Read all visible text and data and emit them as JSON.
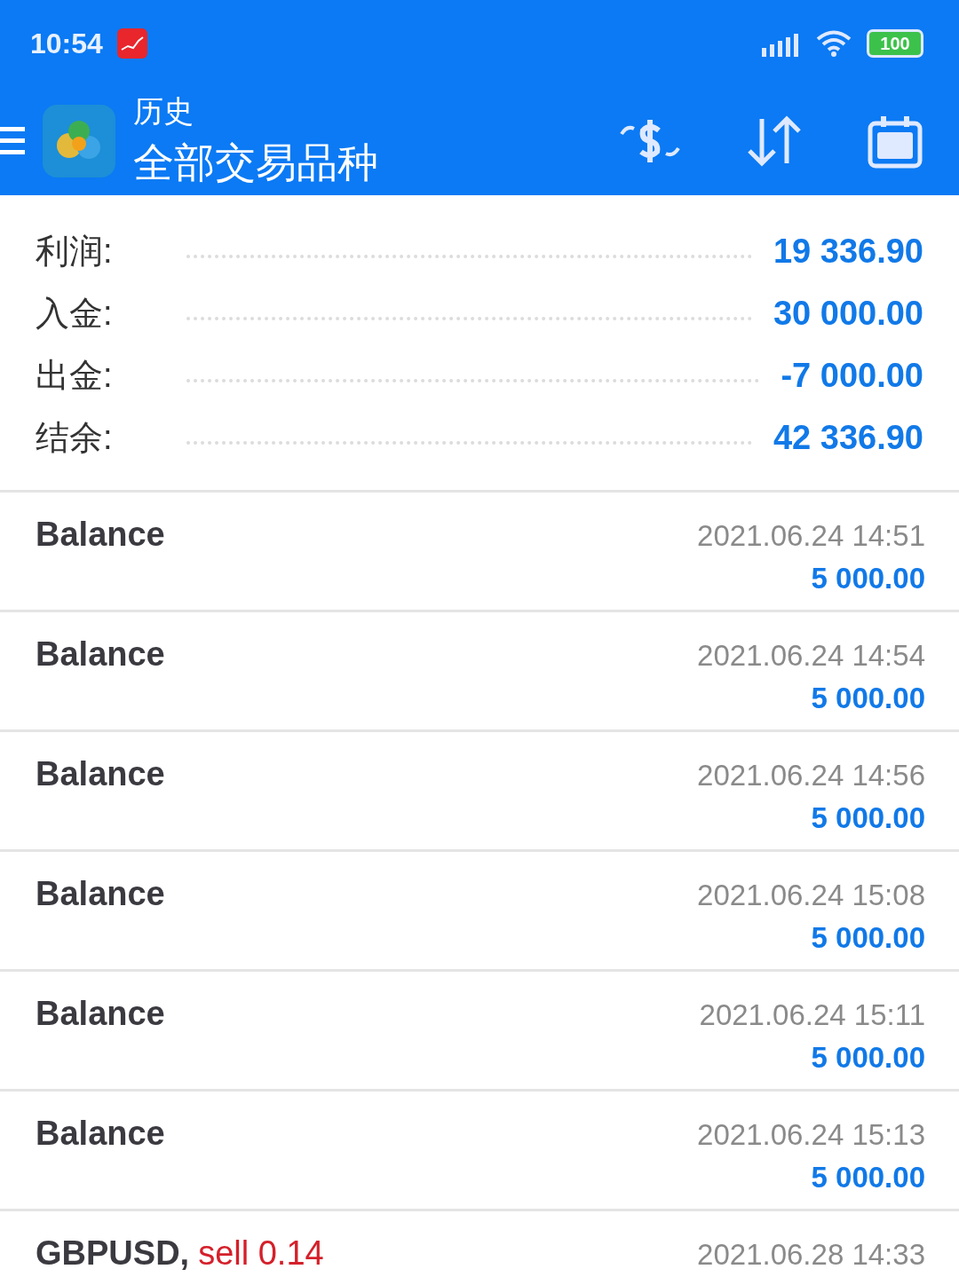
{
  "status_bar": {
    "time": "10:54",
    "battery": "100"
  },
  "header": {
    "title": "历史",
    "subtitle": "全部交易品种"
  },
  "summary": [
    {
      "label": "利润:",
      "value": "19 336.90"
    },
    {
      "label": "入金:",
      "value": "30 000.00"
    },
    {
      "label": "出金:",
      "value": "-7 000.00"
    },
    {
      "label": "结余:",
      "value": "42 336.90"
    }
  ],
  "deals": [
    {
      "kind": "balance",
      "title": "Balance",
      "time": "2021.06.24 14:51",
      "amount": "5 000.00"
    },
    {
      "kind": "balance",
      "title": "Balance",
      "time": "2021.06.24 14:54",
      "amount": "5 000.00"
    },
    {
      "kind": "balance",
      "title": "Balance",
      "time": "2021.06.24 14:56",
      "amount": "5 000.00"
    },
    {
      "kind": "balance",
      "title": "Balance",
      "time": "2021.06.24 15:08",
      "amount": "5 000.00"
    },
    {
      "kind": "balance",
      "title": "Balance",
      "time": "2021.06.24 15:11",
      "amount": "5 000.00"
    },
    {
      "kind": "balance",
      "title": "Balance",
      "time": "2021.06.24 15:13",
      "amount": "5 000.00"
    },
    {
      "kind": "trade",
      "title": "GBPUSD,",
      "order": "sell 0.14",
      "time": "2021.06.28 14:33"
    }
  ]
}
